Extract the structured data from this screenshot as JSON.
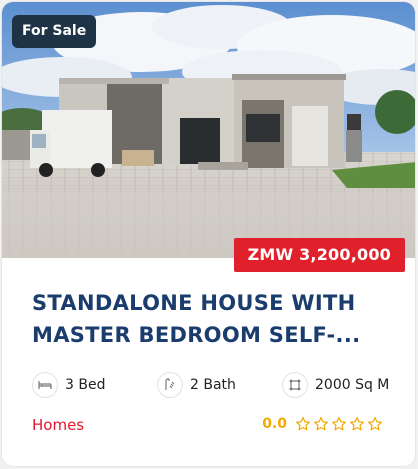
{
  "listing": {
    "badge": "For Sale",
    "price": "ZMW 3,200,000",
    "title_line1": "STANDALONE HOUSE WITH",
    "title_line2": "MASTER BEDROOM SELF-...",
    "features": [
      {
        "icon": "bed-icon",
        "label": "3 Bed"
      },
      {
        "icon": "bath-icon",
        "label": "2 Bath"
      },
      {
        "icon": "area-icon",
        "label": "2000 Sq M"
      }
    ],
    "category": "Homes",
    "rating": "0.0",
    "stars_filled": 0,
    "stars_total": 5
  },
  "colors": {
    "badge_bg": "#1f3346",
    "price_bg": "#e0202a",
    "title": "#1a3d6d",
    "category": "#e3162b",
    "rating": "#f2a900"
  }
}
